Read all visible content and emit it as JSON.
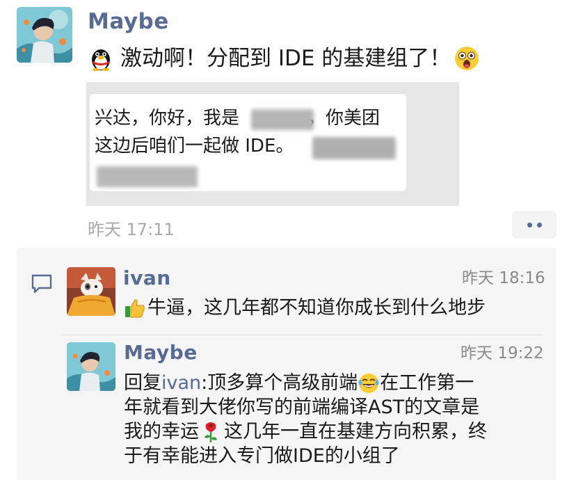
{
  "post": {
    "author": "Maybe",
    "text": "激动啊！分配到 IDE 的基建组了！",
    "emoji_leading": "penguin-emoji",
    "emoji_trailing": "astonished-face-emoji",
    "time": "昨天 17:11",
    "screenshot": {
      "line1": "兴达，你好，我是",
      "line1_tail": "，你美团",
      "line2": "这边后咱们一起做 IDE。"
    }
  },
  "comments": [
    {
      "author": "ivan",
      "time": "昨天 18:16",
      "emoji": "thumbs-up-emoji",
      "text": "牛逼，这几年都不知道你成长到什么地步"
    },
    {
      "author": "Maybe",
      "time": "昨天 19:22",
      "reply_prefix": "回复",
      "reply_to": "ivan",
      "line1": "顶多算个高级前端",
      "line1_tail": " 在工作第一",
      "line2": "年就看到大佬你写的前端编译AST的文章是",
      "line3": "我的幸运",
      "line3_tail": "这几年一直在基建方向积累，终",
      "line4": "于有幸能进入专门做IDE的小组了",
      "emoji_1": "rolling-laughing-emoji",
      "emoji_2": "rose-emoji"
    }
  ],
  "colors": {
    "name_blue": "#576b95",
    "time_gray": "#a8a8a8",
    "comment_bg": "#f5f5f5",
    "screenshot_bg": "#e6e6e6"
  }
}
